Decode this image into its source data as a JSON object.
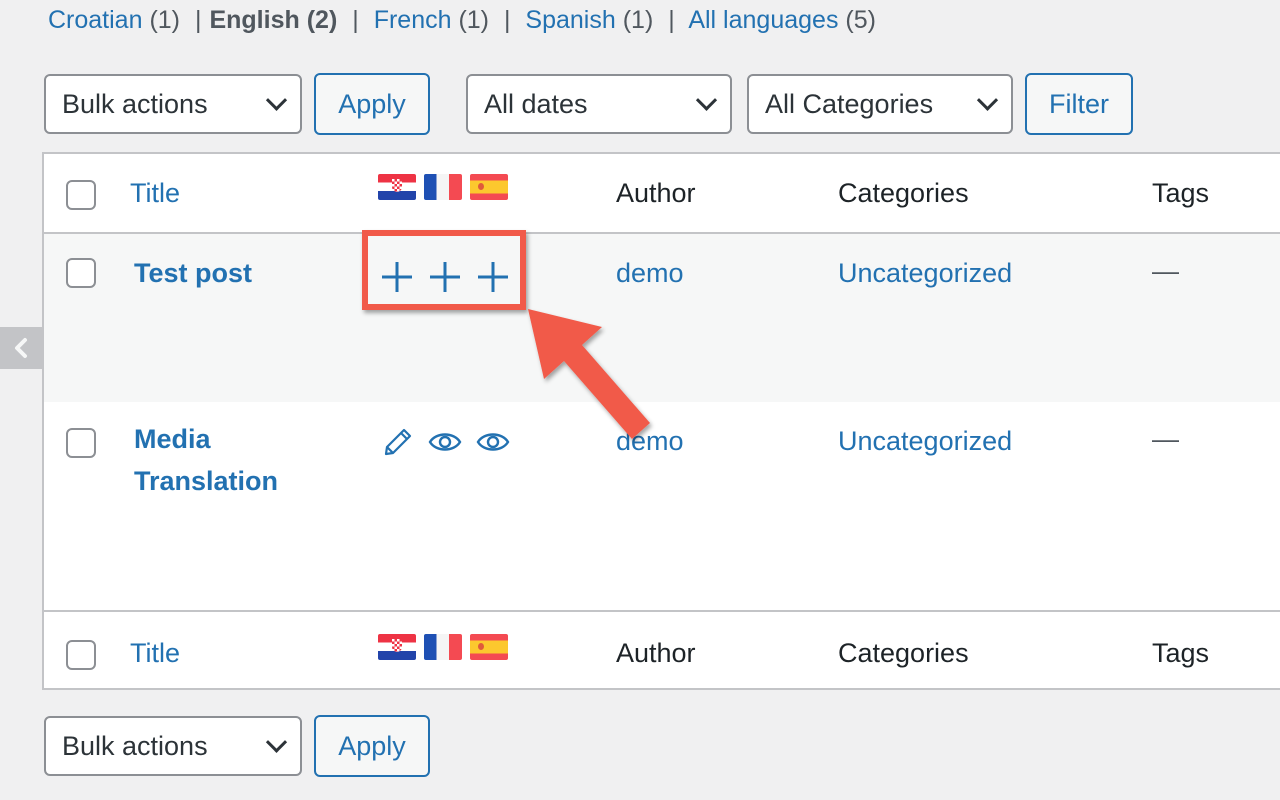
{
  "language_filter": {
    "items": [
      {
        "label": "Croatian",
        "count": "(1)",
        "current": false
      },
      {
        "label": "English",
        "count": "(2)",
        "current": true
      },
      {
        "label": "French",
        "count": "(1)",
        "current": false
      },
      {
        "label": "Spanish",
        "count": "(1)",
        "current": false
      },
      {
        "label": "All languages",
        "count": "(5)",
        "current": false
      }
    ],
    "separator": "|"
  },
  "top_toolbar": {
    "bulk_actions": "Bulk actions",
    "apply": "Apply",
    "dates": "All dates",
    "categories": "All Categories",
    "filter": "Filter"
  },
  "bottom_toolbar": {
    "bulk_actions": "Bulk actions",
    "apply": "Apply"
  },
  "table": {
    "columns": {
      "title": "Title",
      "author": "Author",
      "categories": "Categories",
      "tags": "Tags"
    },
    "language_flags": [
      "Croatian flag",
      "French flag",
      "Spanish flag"
    ],
    "rows": [
      {
        "title": "Test post",
        "translation_actions": [
          "add",
          "add",
          "add"
        ],
        "author": "demo",
        "categories": "Uncategorized",
        "tags": "—"
      },
      {
        "title_line1": "Media",
        "title_line2": "Translation",
        "translation_actions": [
          "edit",
          "view",
          "view"
        ],
        "author": "demo",
        "categories": "Uncategorized",
        "tags": "—"
      }
    ]
  },
  "annotation": {
    "highlight_color": "#f15a4a"
  },
  "colors": {
    "link": "#2271b1",
    "background": "#f0f0f1"
  }
}
